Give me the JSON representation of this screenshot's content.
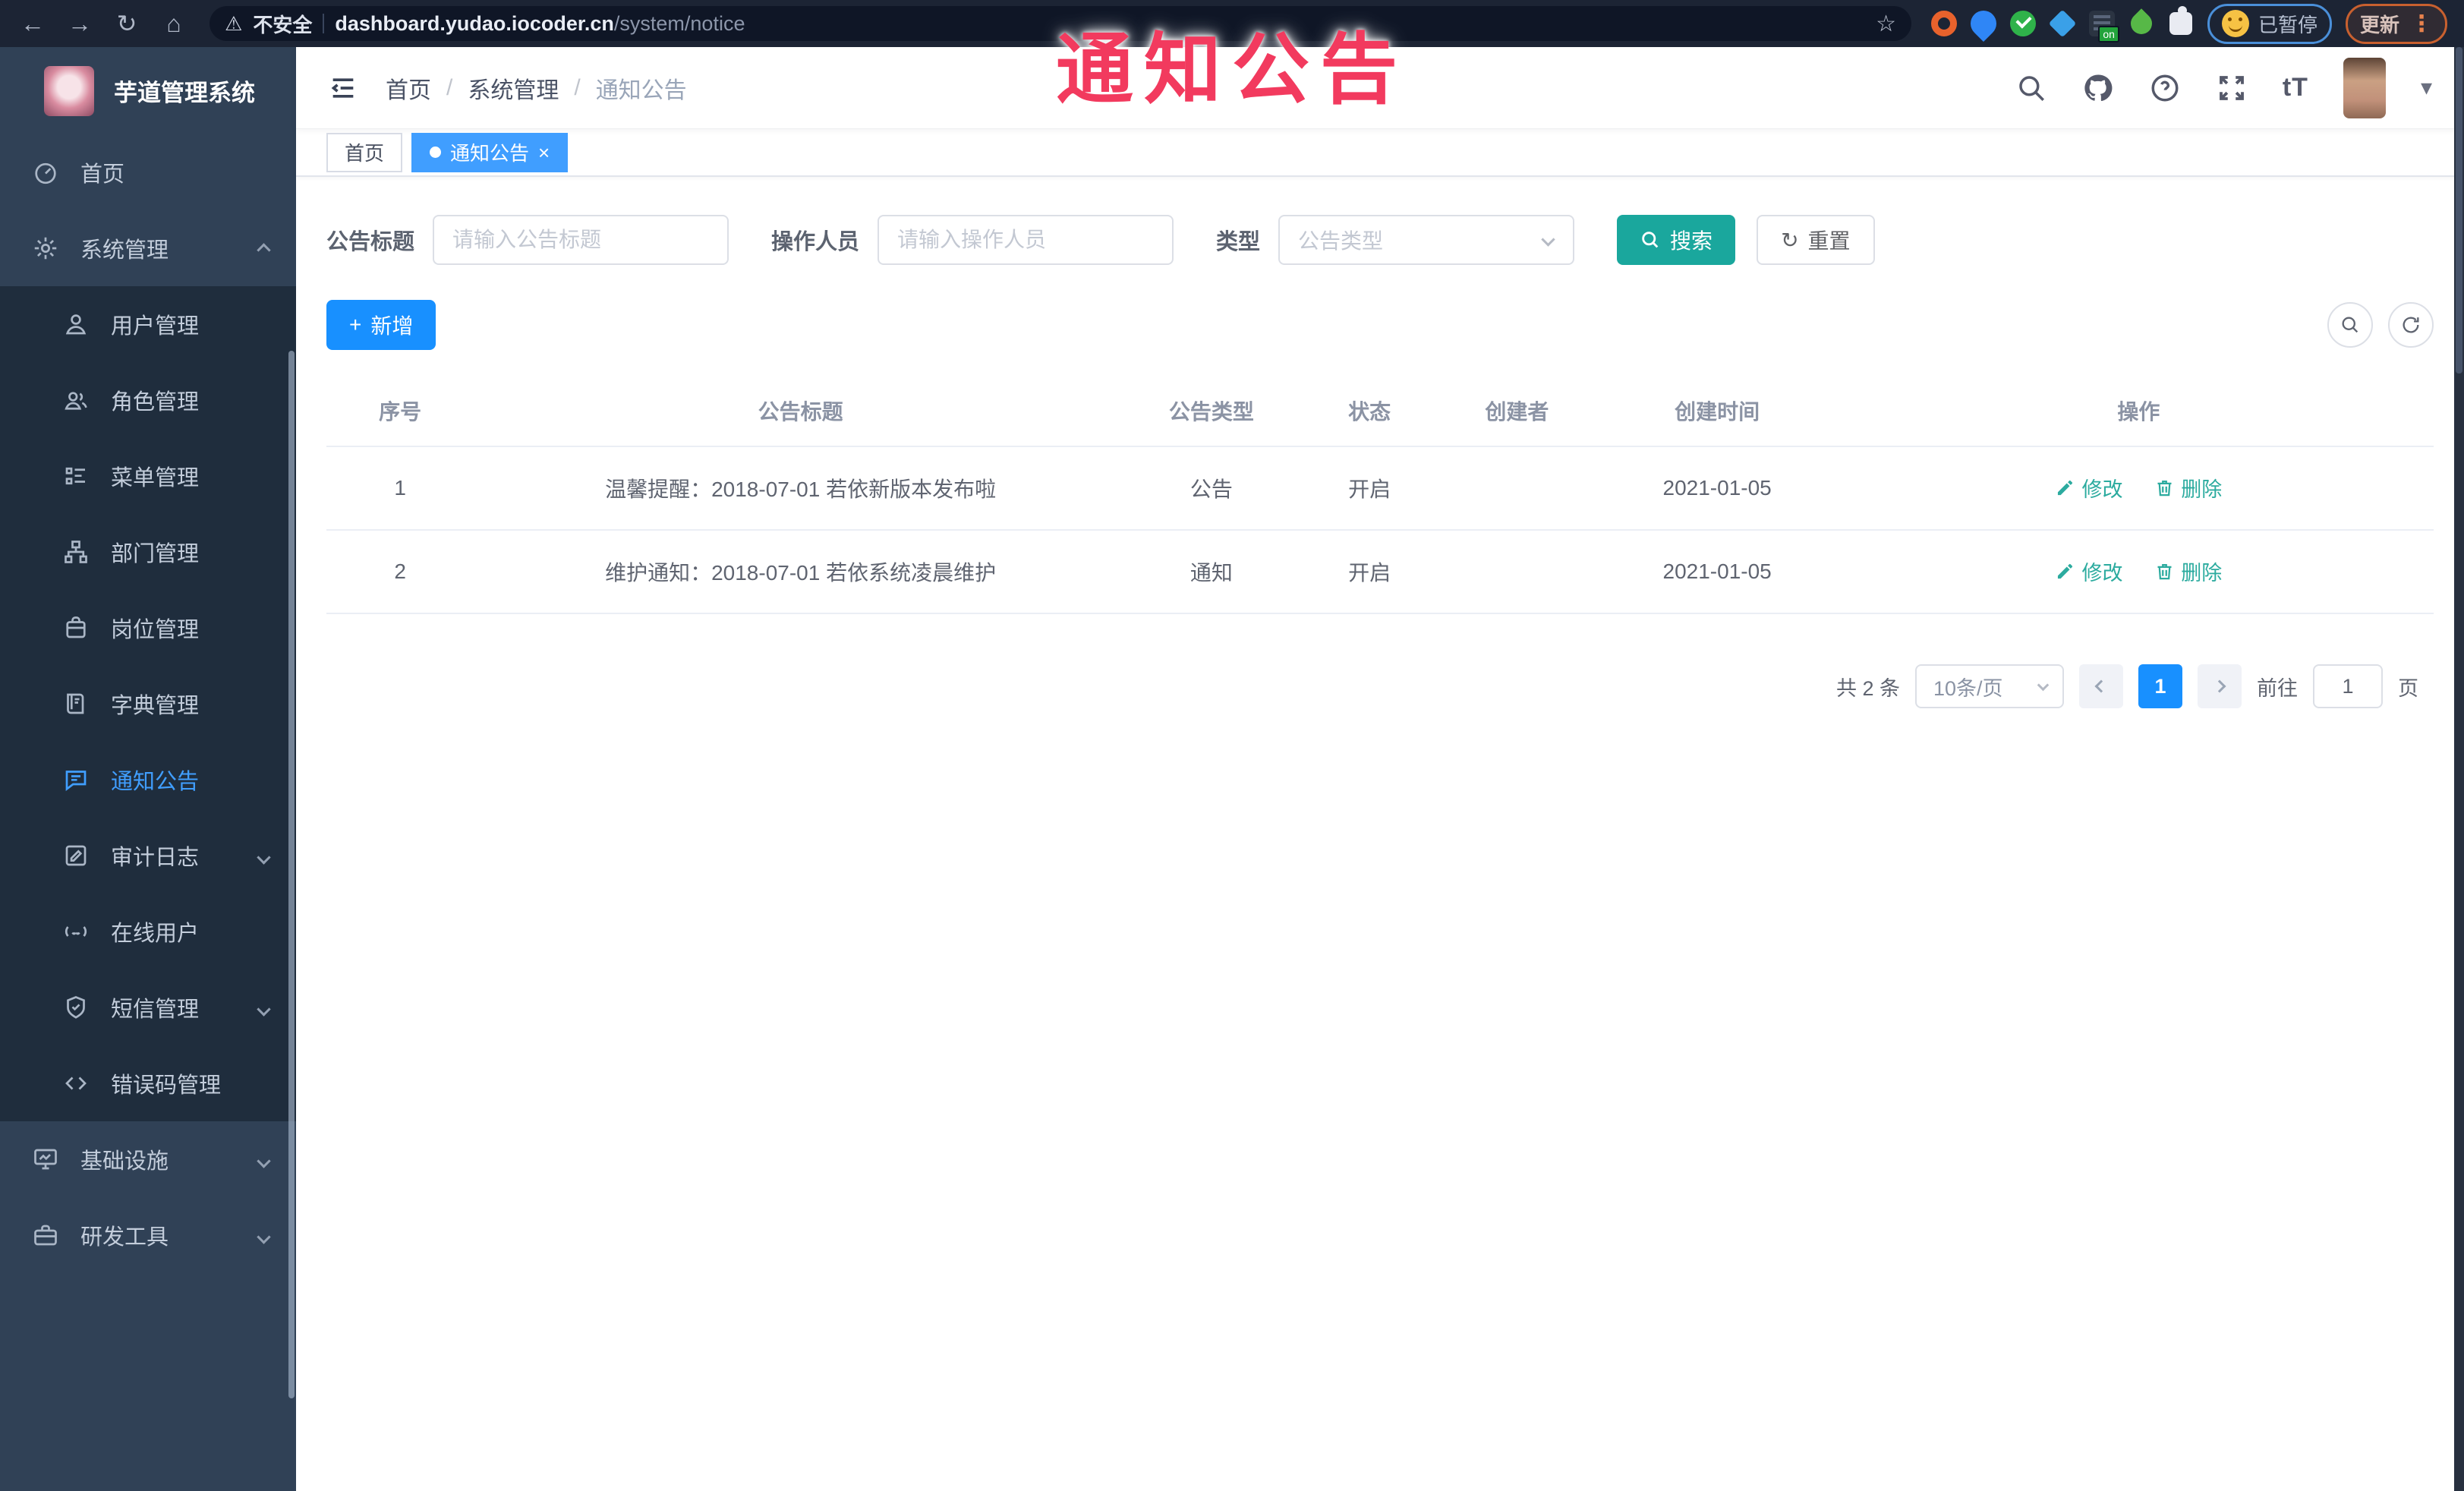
{
  "browser": {
    "security_label": "不安全",
    "url_domain": "dashboard.yudao.iocoder.cn",
    "url_path": "/system/notice",
    "extension_on_badge": "on",
    "paused_badge": "已暂停",
    "update_button": "更新"
  },
  "annotation": {
    "title": "通知公告"
  },
  "icons": {
    "back": "←",
    "forward": "→",
    "reload": "↻",
    "home": "⌂",
    "star": "☆",
    "warning": "⚠",
    "caret_down": "▾",
    "close": "×",
    "plus": "+",
    "reset": "↻",
    "ellipsis": "⋮",
    "font_size": "tT"
  },
  "sidebar": {
    "logo_title": "芋道管理系统",
    "top_items": [
      {
        "label": "首页",
        "icon": "dashboard-icon"
      },
      {
        "label": "系统管理",
        "icon": "gear-icon",
        "expanded": true
      }
    ],
    "sub_items": [
      {
        "label": "用户管理",
        "icon": "user-icon"
      },
      {
        "label": "角色管理",
        "icon": "users-icon"
      },
      {
        "label": "菜单管理",
        "icon": "menu-list-icon"
      },
      {
        "label": "部门管理",
        "icon": "org-tree-icon"
      },
      {
        "label": "岗位管理",
        "icon": "badge-icon"
      },
      {
        "label": "字典管理",
        "icon": "dictionary-icon"
      },
      {
        "label": "通知公告",
        "icon": "notice-icon",
        "active": true
      },
      {
        "label": "审计日志",
        "icon": "log-icon",
        "has_children": true
      },
      {
        "label": "在线用户",
        "icon": "online-user-icon"
      },
      {
        "label": "短信管理",
        "icon": "sms-icon",
        "has_children": true
      },
      {
        "label": "错误码管理",
        "icon": "code-icon"
      }
    ],
    "bottom_items": [
      {
        "label": "基础设施",
        "icon": "infrastructure-icon",
        "has_children": true
      },
      {
        "label": "研发工具",
        "icon": "devtools-icon",
        "has_children": true
      }
    ]
  },
  "header": {
    "breadcrumb": [
      "首页",
      "系统管理",
      "通知公告"
    ],
    "separator": "/"
  },
  "tabs": [
    {
      "label": "首页",
      "active": false
    },
    {
      "label": "通知公告",
      "active": true
    }
  ],
  "filters": {
    "title_label": "公告标题",
    "title_placeholder": "请输入公告标题",
    "operator_label": "操作人员",
    "operator_placeholder": "请输入操作人员",
    "type_label": "类型",
    "type_placeholder": "公告类型",
    "search_label": "搜索",
    "reset_label": "重置"
  },
  "toolbar": {
    "add_label": "新增"
  },
  "table": {
    "columns": [
      "序号",
      "公告标题",
      "公告类型",
      "状态",
      "创建者",
      "创建时间",
      "操作"
    ],
    "rows": [
      {
        "no": "1",
        "title": "温馨提醒：2018-07-01 若依新版本发布啦",
        "type": "公告",
        "status": "开启",
        "creator": "",
        "created": "2021-01-05",
        "edit": "修改",
        "delete": "删除"
      },
      {
        "no": "2",
        "title": "维护通知：2018-07-01 若依系统凌晨维护",
        "type": "通知",
        "status": "开启",
        "creator": "",
        "created": "2021-01-05",
        "edit": "修改",
        "delete": "删除"
      }
    ]
  },
  "pagination": {
    "total": "共 2 条",
    "page_size": "10条/页",
    "current_page": "1",
    "goto_prefix": "前往",
    "goto_value": "1",
    "goto_suffix": "页"
  },
  "colors": {
    "accent_blue": "#409eff",
    "primary_blue": "#1890ff",
    "teal": "#1aa79d",
    "sidebar_bg": "#304156",
    "submenu_bg": "#1f2d3d",
    "annotation_red": "#f23a5e"
  }
}
